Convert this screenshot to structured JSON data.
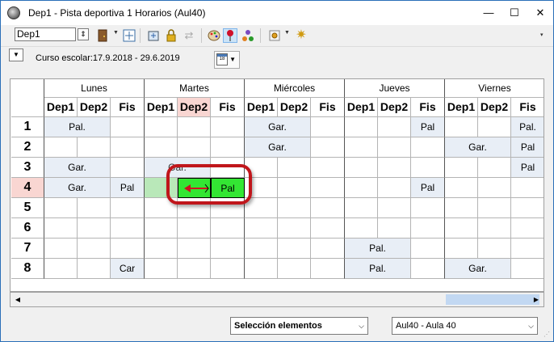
{
  "window": {
    "title": "Dep1 - Pista deportiva 1  Horarios  (Aul40)",
    "minimize": "—",
    "maximize": "☐",
    "close": "✕"
  },
  "toolbar": {
    "element_value": "Dep1",
    "icons": [
      "door-icon",
      "grid-fit-icon",
      "export-icon",
      "lock-icon",
      "swap-icon",
      "palette-icon",
      "pin-icon",
      "share-icon",
      "gear-dropdown-icon",
      "settings-gear-icon"
    ]
  },
  "subbar": {
    "period": "Curso escolar:17.9.2018 - 29.6.2019",
    "calendar_day": "18"
  },
  "timetable": {
    "days": [
      "Lunes",
      "Martes",
      "Miércoles",
      "Jueves",
      "Viernes"
    ],
    "sub_columns": [
      "Dep1",
      "Dep2",
      "Fis"
    ],
    "periods": [
      "1",
      "2",
      "3",
      "4",
      "5",
      "6",
      "7",
      "8"
    ],
    "lessons": [
      {
        "label": "Pal."
      },
      {
        "label": "Gar."
      },
      {
        "label": "Pal"
      },
      {
        "label": "Gar."
      },
      {
        "label": "Pal"
      },
      {
        "label": "Gar."
      },
      {
        "label": "Gar."
      },
      {
        "label": "Pal"
      },
      {
        "label": "Pal"
      },
      {
        "label": "Pal"
      },
      {
        "label": "Pal"
      },
      {
        "label": "Pal."
      },
      {
        "label": "Pal."
      },
      {
        "label": "Car"
      },
      {
        "label": "Gar."
      }
    ],
    "highlight_color": "#33e633",
    "dragging_color": "#b9e8b9",
    "annotation_color": "#c0161b"
  },
  "statusbar": {
    "mode_select": "Selección elementos",
    "room_select": "Aul40 - Aula 40"
  }
}
